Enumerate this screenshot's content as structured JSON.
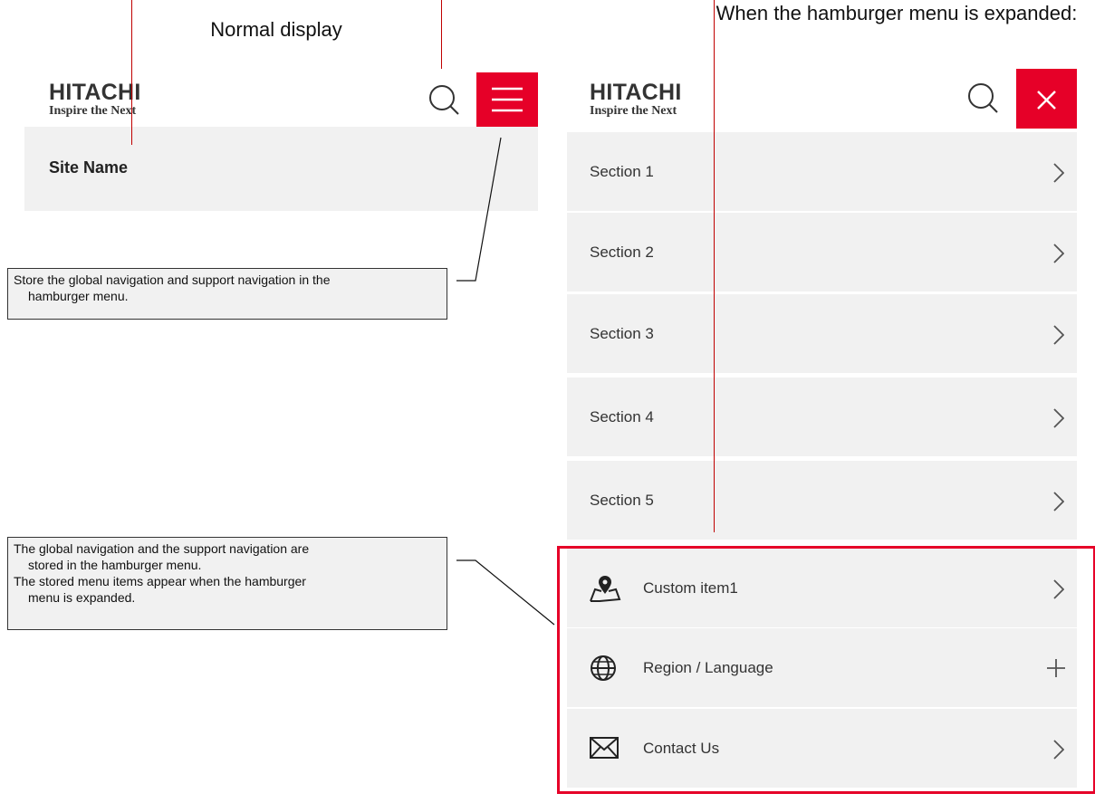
{
  "headings": {
    "normal": "Normal display",
    "expanded": "When the hamburger menu is expanded:"
  },
  "logo": {
    "word": "HITACHI",
    "tagline": "Inspire the Next"
  },
  "site_name": "Site Name",
  "notes": {
    "hamburger": [
      "Store the global navigation and support navigation in the",
      "hamburger menu."
    ],
    "stored": [
      "The global navigation and the support navigation are",
      "stored in the hamburger menu.",
      "The stored menu items appear when the hamburger",
      "menu is expanded."
    ]
  },
  "sections": [
    "Section 1",
    "Section 2",
    "Section 3",
    "Section 4",
    "Section 5"
  ],
  "support_items": [
    {
      "label": "Custom item1",
      "icon": "map-pin-icon",
      "action": "chevron-right-icon"
    },
    {
      "label": "Region / Language",
      "icon": "globe-icon",
      "action": "plus-icon"
    },
    {
      "label": "Contact Us",
      "icon": "mail-icon",
      "action": "chevron-right-icon"
    }
  ],
  "colors": {
    "brand_red": "#e60028",
    "menu_bg": "#f1f1f1",
    "annotation_line": "#c00000",
    "highlight_box": "#e60028"
  },
  "icons": {
    "search": "search-icon",
    "hamburger": "hamburger-icon",
    "close": "close-icon"
  }
}
